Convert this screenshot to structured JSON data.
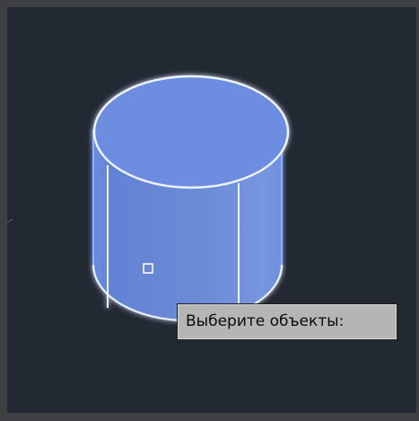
{
  "viewport": {
    "background": "#222933",
    "object": {
      "type": "cylinder",
      "state": "selected",
      "fill": "#6d8fd8",
      "edge": "#e6eeff",
      "glow": "#4f7dff"
    },
    "cursor_icon": "pickbox-square-icon"
  },
  "tooltip": {
    "text": "Выберите объекты:"
  }
}
